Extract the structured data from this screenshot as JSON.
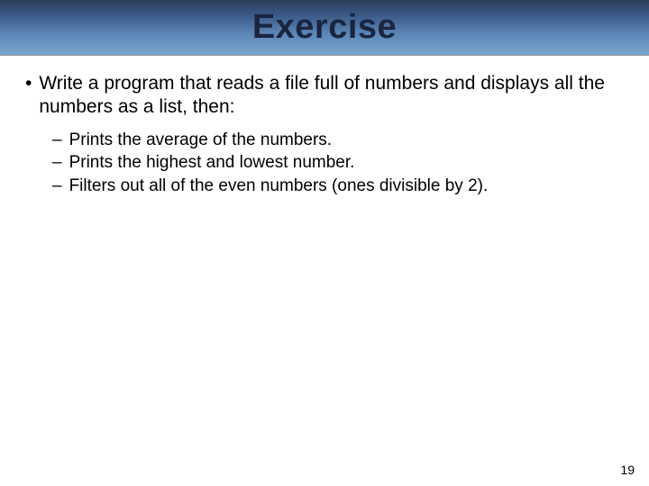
{
  "slide": {
    "title": "Exercise",
    "main_bullet": "Write a program that reads a file full of numbers and displays all the numbers as a list, then:",
    "sub_bullets": [
      "Prints the average of the numbers.",
      "Prints the highest and lowest number.",
      "Filters out all of the even numbers (ones divisible by 2)."
    ],
    "page_number": "19"
  }
}
